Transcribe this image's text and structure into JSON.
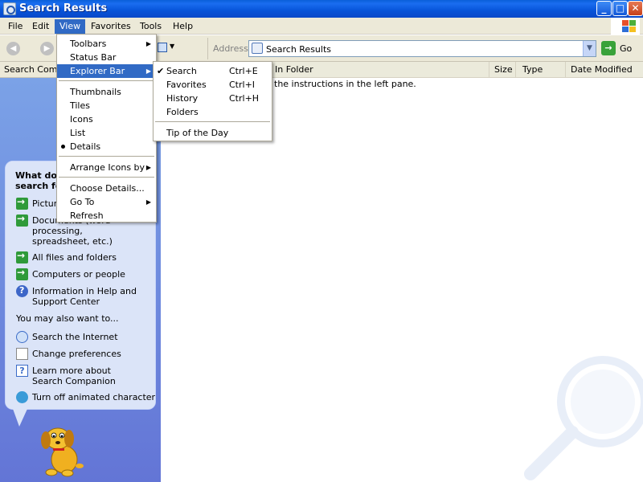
{
  "window": {
    "title": "Search Results"
  },
  "menubar": {
    "items": [
      "File",
      "Edit",
      "View",
      "Favorites",
      "Tools",
      "Help"
    ]
  },
  "toolbar": {
    "address_label": "Address",
    "address_value": "Search Results",
    "go_label": "Go"
  },
  "left_header": "Search Companion",
  "columns": [
    "In Folder",
    "Size",
    "Type",
    "Date Modified"
  ],
  "content_message": "the instructions in the left pane.",
  "companion": {
    "question": "What do you want to search for?",
    "options": [
      {
        "label": "Pictures, music, or video",
        "icon": "arrow-icon"
      },
      {
        "label": "Documents (word processing, spreadsheet, etc.)",
        "icon": "arrow-icon"
      },
      {
        "label": "All files and folders",
        "icon": "arrow-icon"
      },
      {
        "label": "Computers or people",
        "icon": "arrow-icon"
      },
      {
        "label": "Information in Help and Support Center",
        "icon": "help-icon"
      }
    ],
    "also_label": "You may also want to...",
    "also_items": [
      {
        "label": "Search the Internet",
        "icon": "search-internet-icon"
      },
      {
        "label": "Change preferences",
        "icon": "preferences-icon"
      },
      {
        "label": "Learn more about Search Companion",
        "icon": "help-icon"
      },
      {
        "label": "Turn off animated character",
        "icon": "character-icon"
      }
    ]
  },
  "view_menu": {
    "items": [
      {
        "label": "Toolbars",
        "submenu": true
      },
      {
        "label": "Status Bar"
      },
      {
        "label": "Explorer Bar",
        "submenu": true,
        "highlighted": true
      },
      {
        "label": "Thumbnails"
      },
      {
        "label": "Tiles"
      },
      {
        "label": "Icons"
      },
      {
        "label": "List"
      },
      {
        "label": "Details",
        "selected": true
      },
      {
        "label": "Arrange Icons by",
        "submenu": true
      },
      {
        "label": "Choose Details..."
      },
      {
        "label": "Go To",
        "submenu": true
      },
      {
        "label": "Refresh"
      }
    ]
  },
  "explorer_bar_menu": {
    "items": [
      {
        "label": "Search",
        "shortcut": "Ctrl+E",
        "checked": true
      },
      {
        "label": "Favorites",
        "shortcut": "Ctrl+I"
      },
      {
        "label": "History",
        "shortcut": "Ctrl+H"
      },
      {
        "label": "Folders",
        "shortcut": ""
      },
      {
        "label": "Tip of the Day",
        "shortcut": ""
      }
    ]
  },
  "colors": {
    "title_bar": "#0a5fd8",
    "menu_highlight": "#316ac5",
    "left_pane": "#7ba2e7"
  }
}
